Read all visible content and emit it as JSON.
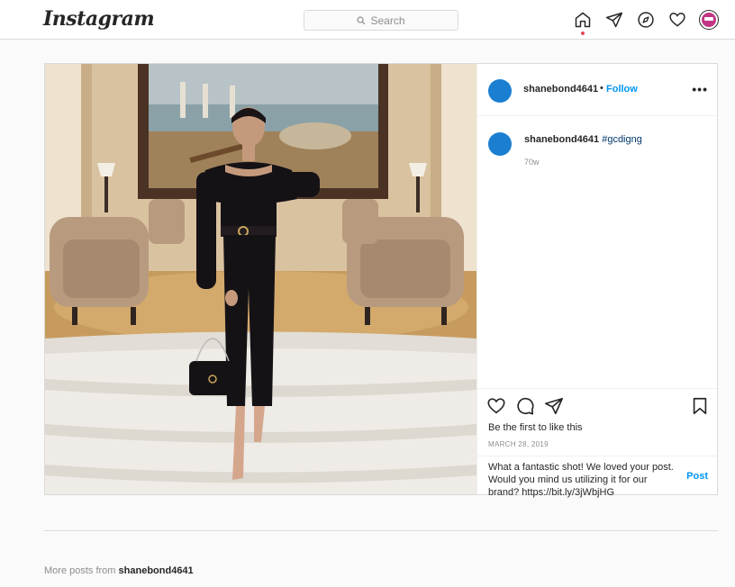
{
  "nav": {
    "logo": "Instagram",
    "search_placeholder": "Search",
    "icons": [
      "home-icon",
      "direct-icon",
      "explore-icon",
      "activity-heart-icon",
      "profile-avatar"
    ]
  },
  "post": {
    "username": "shanebond4641",
    "separator": "•",
    "follow": "Follow",
    "more": "•••",
    "caption_user": "shanebond4641",
    "caption_tag": "#gcdigng",
    "age": "70w",
    "likes": "Be the first to like this",
    "date": "MARCH 28, 2019",
    "comment_text": "What a fantastic shot! We loved your post. Would you mind us utilizing it for our brand? https://bit.ly/3jWbjHG",
    "post_button": "Post"
  },
  "footer": {
    "more_posts_prefix": "More posts from",
    "more_posts_user": "shanebond4641"
  },
  "colors": {
    "accent": "#0095f6",
    "avatar": "#1a7fd1",
    "notification_dot": "#ed4956"
  }
}
